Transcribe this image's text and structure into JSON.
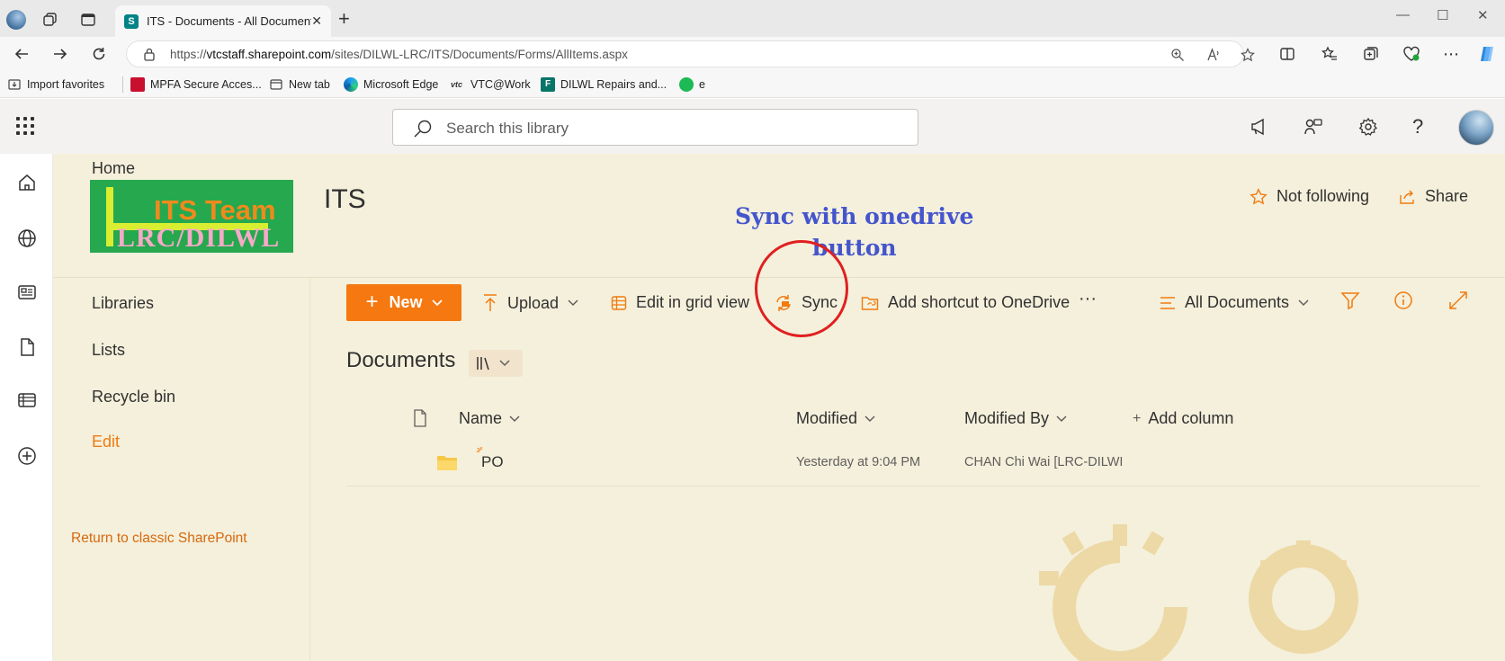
{
  "browser": {
    "tab_title": "ITS - Documents - All Documents",
    "tab_favicon_letter": "S",
    "url_prefix": "https://",
    "url_host": "vtcstaff.sharepoint.com",
    "url_path": "/sites/DILWL-LRC/ITS/Documents/Forms/AllItems.aspx",
    "bookmarks": [
      {
        "label": "Import favorites",
        "icon": "import-favorites-icon"
      },
      {
        "label": "MPFA Secure Acces...",
        "icon": "mpfa-icon"
      },
      {
        "label": "New tab",
        "icon": "new-tab-icon"
      },
      {
        "label": "Microsoft Edge",
        "icon": "edge-icon"
      },
      {
        "label": "VTC@Work",
        "icon": "vtc-icon"
      },
      {
        "label": "DILWL Repairs and...",
        "icon": "forms-icon"
      },
      {
        "label": "e",
        "icon": "green-circle-icon"
      }
    ]
  },
  "suite": {
    "search_placeholder": "Search this library"
  },
  "site": {
    "home_link": "Home",
    "logo_line1": "ITS Team",
    "logo_line2": "LRC/DILWL",
    "title": "ITS",
    "not_following": "Not following",
    "share": "Share"
  },
  "leftnav": {
    "items": [
      "Libraries",
      "Lists",
      "Recycle bin"
    ],
    "edit": "Edit",
    "return_classic": "Return to classic SharePoint"
  },
  "commandbar": {
    "new_label": "New",
    "upload_label": "Upload",
    "grid_label": "Edit in grid view",
    "sync_label": "Sync",
    "shortcut_label": "Add shortcut to OneDrive",
    "more_label": "···",
    "view_label": "All Documents"
  },
  "annotation": {
    "line1": "Sync with onedrive",
    "line2": "button",
    "color": "#4455cc",
    "ring_color": "#e02020"
  },
  "library": {
    "title": "Documents",
    "columns": {
      "name": "Name",
      "modified": "Modified",
      "modified_by": "Modified By",
      "add_column": "Add column"
    },
    "rows": [
      {
        "name": "PO",
        "modified": "Yesterday at 9:04 PM",
        "modified_by": "CHAN Chi Wai [LRC-DILWI"
      }
    ]
  },
  "colors": {
    "accent": "#f57810",
    "site_bg": "#f4f0dc"
  }
}
